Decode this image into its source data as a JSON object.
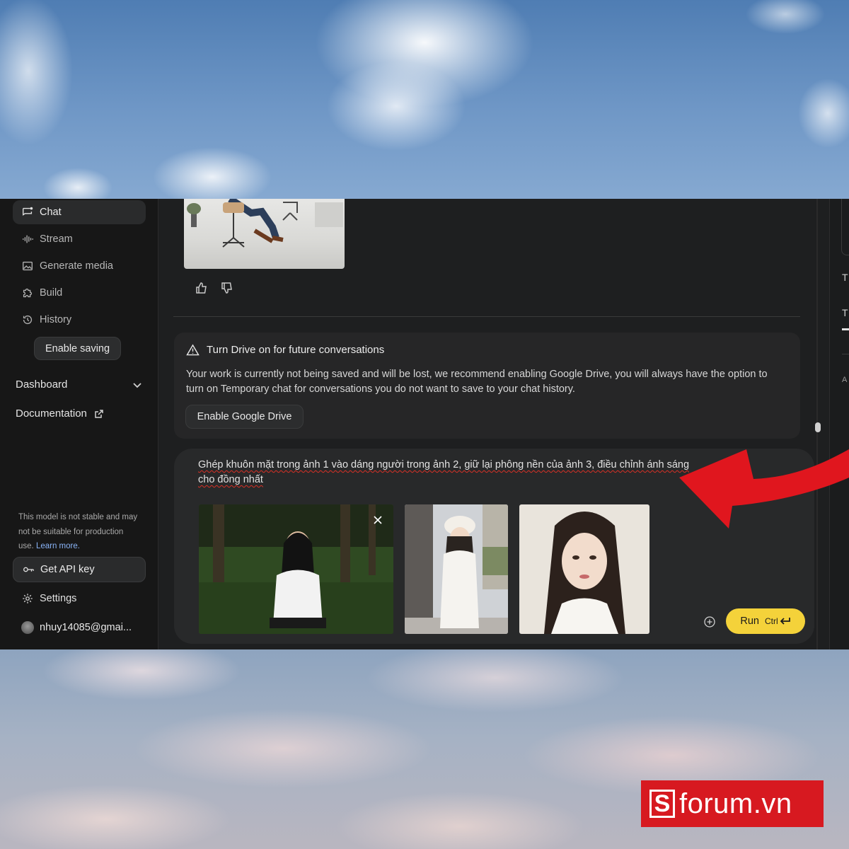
{
  "sidebar": {
    "items": [
      {
        "label": "Chat",
        "icon": "chat-icon",
        "active": true
      },
      {
        "label": "Stream",
        "icon": "stream-icon"
      },
      {
        "label": "Generate media",
        "icon": "image-icon"
      },
      {
        "label": "Build",
        "icon": "puzzle-icon"
      },
      {
        "label": "History",
        "icon": "history-icon"
      }
    ],
    "enable_saving": "Enable saving",
    "dashboard": "Dashboard",
    "documentation": "Documentation",
    "notice_text": "This model is not stable and may not be suitable for production use.",
    "notice_link": "Learn more.",
    "get_api_key": "Get API key",
    "settings": "Settings",
    "account": "nhuy14085@gmai..."
  },
  "drive_card": {
    "title": "Turn Drive on for future conversations",
    "body": "Your work is currently not being saved and will be lost, we recommend enabling Google Drive, you will always have the option to turn on Temporary chat for conversations you do not want to save to your chat history.",
    "button": "Enable Google Drive"
  },
  "composer": {
    "prompt": "Ghép khuôn mặt trong ảnh 1 vào dáng người trong ảnh 2, giữ lại phông nền của ảnh 3, điều chỉnh ánh sáng cho đồng nhất",
    "run_label": "Run",
    "shortcut": "Ctrl"
  },
  "right_panel": {
    "letters": [
      "T",
      "T",
      "A"
    ]
  },
  "logo": {
    "s": "S",
    "text": "forum.vn"
  },
  "colors": {
    "accent": "#f4d23a",
    "arrow": "#e0161e",
    "logo_bg": "#d71920",
    "link": "#8ab4f8"
  }
}
